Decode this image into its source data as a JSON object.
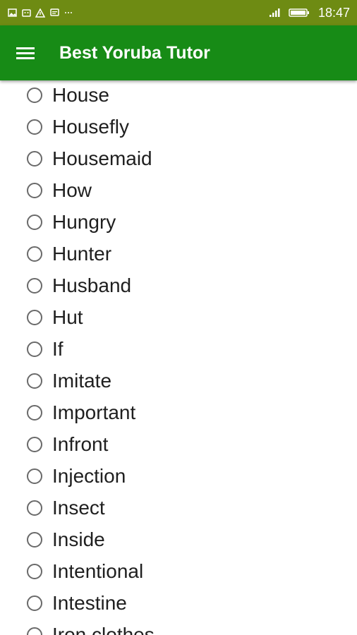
{
  "status_bar": {
    "left_icons": [
      "image-icon",
      "android-icon",
      "warning-icon",
      "message-icon",
      "more-icon"
    ],
    "right_icons": [
      "signal-icon",
      "battery-icon"
    ],
    "time": "18:47"
  },
  "toolbar": {
    "menu_icon": "hamburger-menu-icon",
    "title": "Best Yoruba Tutor"
  },
  "colors": {
    "status_bar": "#6e8b13",
    "toolbar": "#178b16",
    "text": "#1f1f1f",
    "radio_border": "#6a6a6a"
  },
  "options": [
    "House",
    "Housefly",
    "Housemaid",
    "How",
    "Hungry",
    "Hunter",
    "Husband",
    "Hut",
    "If",
    "Imitate",
    "Important",
    "Infront",
    "Injection",
    "Insect",
    "Inside",
    "Intentional",
    "Intestine",
    "Iron clothes"
  ]
}
